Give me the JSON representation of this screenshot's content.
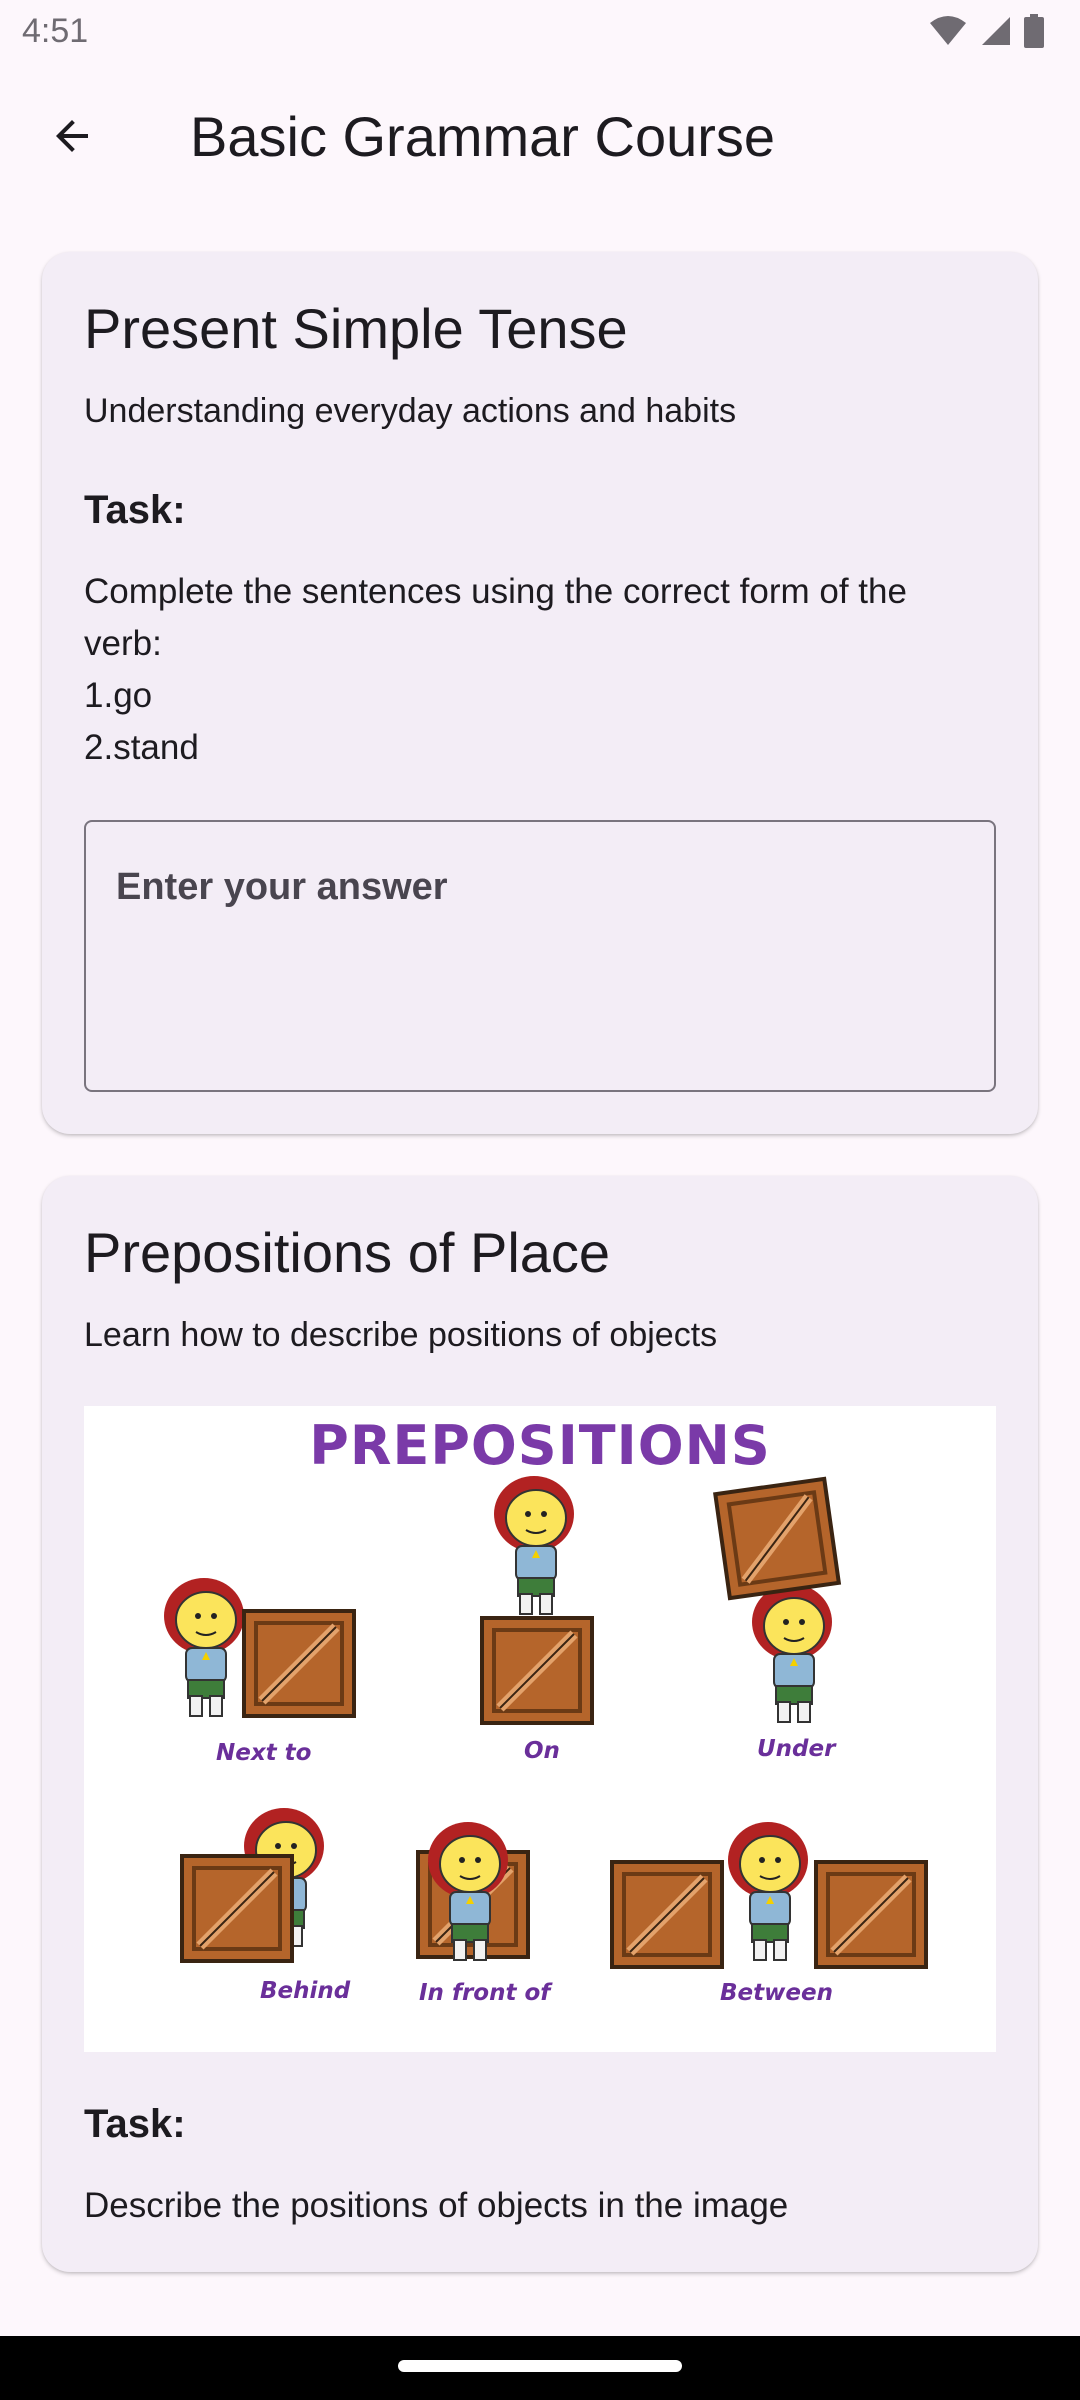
{
  "status": {
    "time": "4:51"
  },
  "app_bar": {
    "title": "Basic Grammar Course"
  },
  "lessons": [
    {
      "title": "Present Simple Tense",
      "subtitle": "Understanding everyday actions and habits",
      "task_label": "Task:",
      "task_lines": [
        "Complete the sentences using the correct form of the",
        "verb:",
        "1.go",
        "2.stand"
      ],
      "answer_placeholder": "Enter your answer"
    },
    {
      "title": "Prepositions of Place",
      "subtitle": "Learn how to describe positions of objects",
      "image": {
        "heading": "PREPOSITIONS",
        "labels": [
          "Next to",
          "On",
          "Under",
          "Behind",
          "In front of",
          "Between"
        ]
      },
      "task_label": "Task:",
      "task_text": "Describe the positions of objects in the image"
    }
  ],
  "colors": {
    "background": "#FDF7FC",
    "card": "#F3EDF6",
    "heading_purple": "#7A3AA8",
    "crate": "#B5652B"
  },
  "icons": [
    "wifi-icon",
    "signal-icon",
    "battery-icon",
    "arrow-back-icon"
  ]
}
